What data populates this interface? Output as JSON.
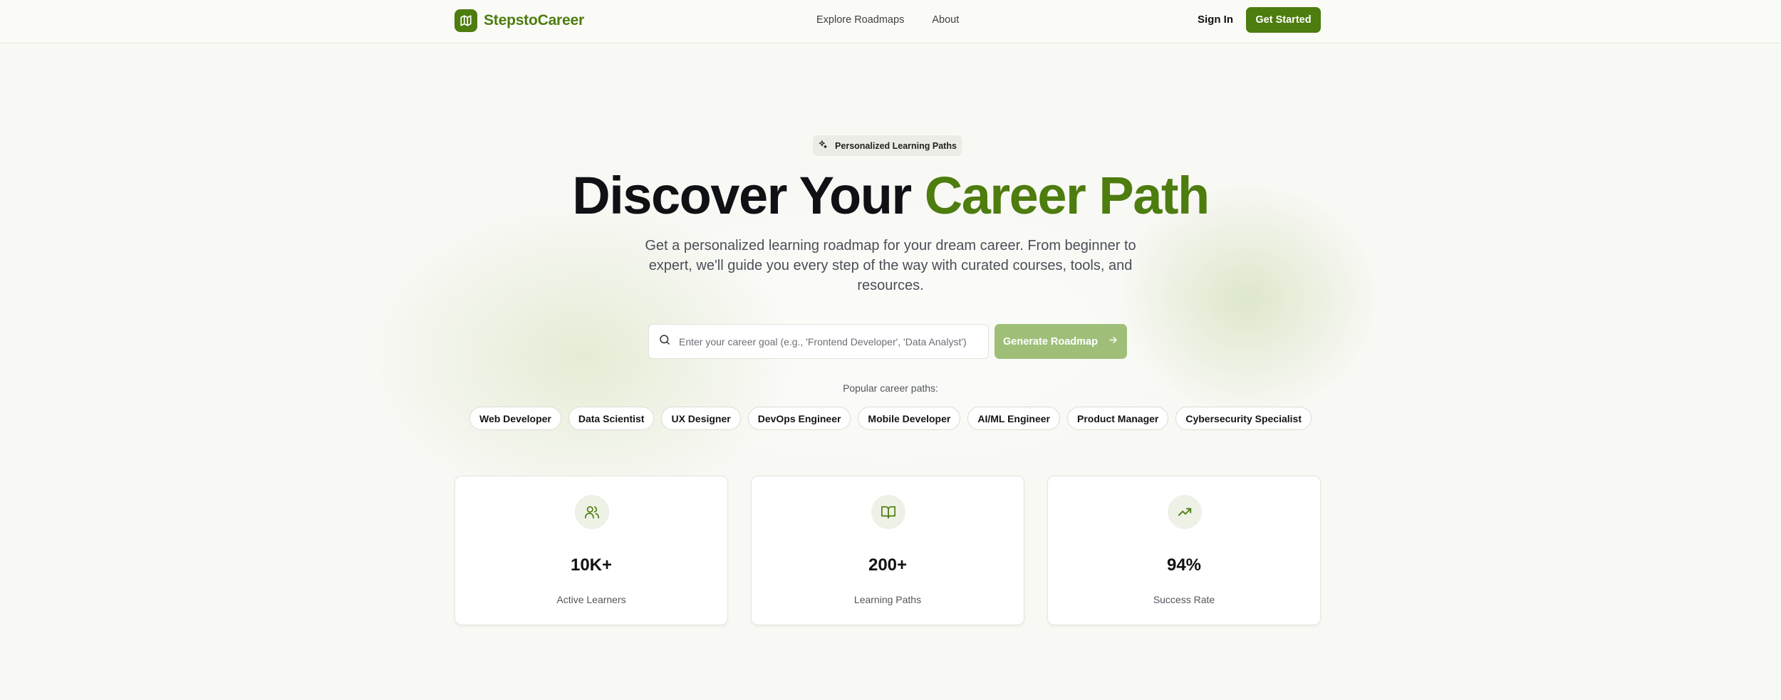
{
  "brand": {
    "name": "StepstoCareer",
    "icon": "map-icon"
  },
  "nav": {
    "links": [
      "Explore Roadmaps",
      "About"
    ],
    "sign_in": "Sign In",
    "get_started": "Get Started"
  },
  "hero": {
    "badge": {
      "icon": "sparkles-icon",
      "label": "Personalized Learning Paths"
    },
    "headline_plain": "Discover Your",
    "headline_accent": "Career Path",
    "subheading": "Get a personalized learning roadmap for your dream career. From beginner to expert, we'll guide you every step of the way with curated courses, tools, and resources."
  },
  "search": {
    "icon": "search-icon",
    "placeholder": "Enter your career goal (e.g., 'Frontend Developer', 'Data Analyst')",
    "value": "",
    "button_label": "Generate Roadmap",
    "button_icon": "arrow-right-icon"
  },
  "popular": {
    "label": "Popular career paths:",
    "paths": [
      "Web Developer",
      "Data Scientist",
      "UX Designer",
      "DevOps Engineer",
      "Mobile Developer",
      "AI/ML Engineer",
      "Product Manager",
      "Cybersecurity Specialist"
    ]
  },
  "stats": [
    {
      "icon": "users-icon",
      "value": "10K+",
      "label": "Active Learners"
    },
    {
      "icon": "book-open-icon",
      "value": "200+",
      "label": "Learning Paths"
    },
    {
      "icon": "trending-up-icon",
      "value": "94%",
      "label": "Success Rate"
    }
  ],
  "colors": {
    "brand": "#4d7c0f",
    "brand_disabled": "#9fbf79",
    "background": "#f8f8f4",
    "icon_bg": "#eef1e6"
  }
}
